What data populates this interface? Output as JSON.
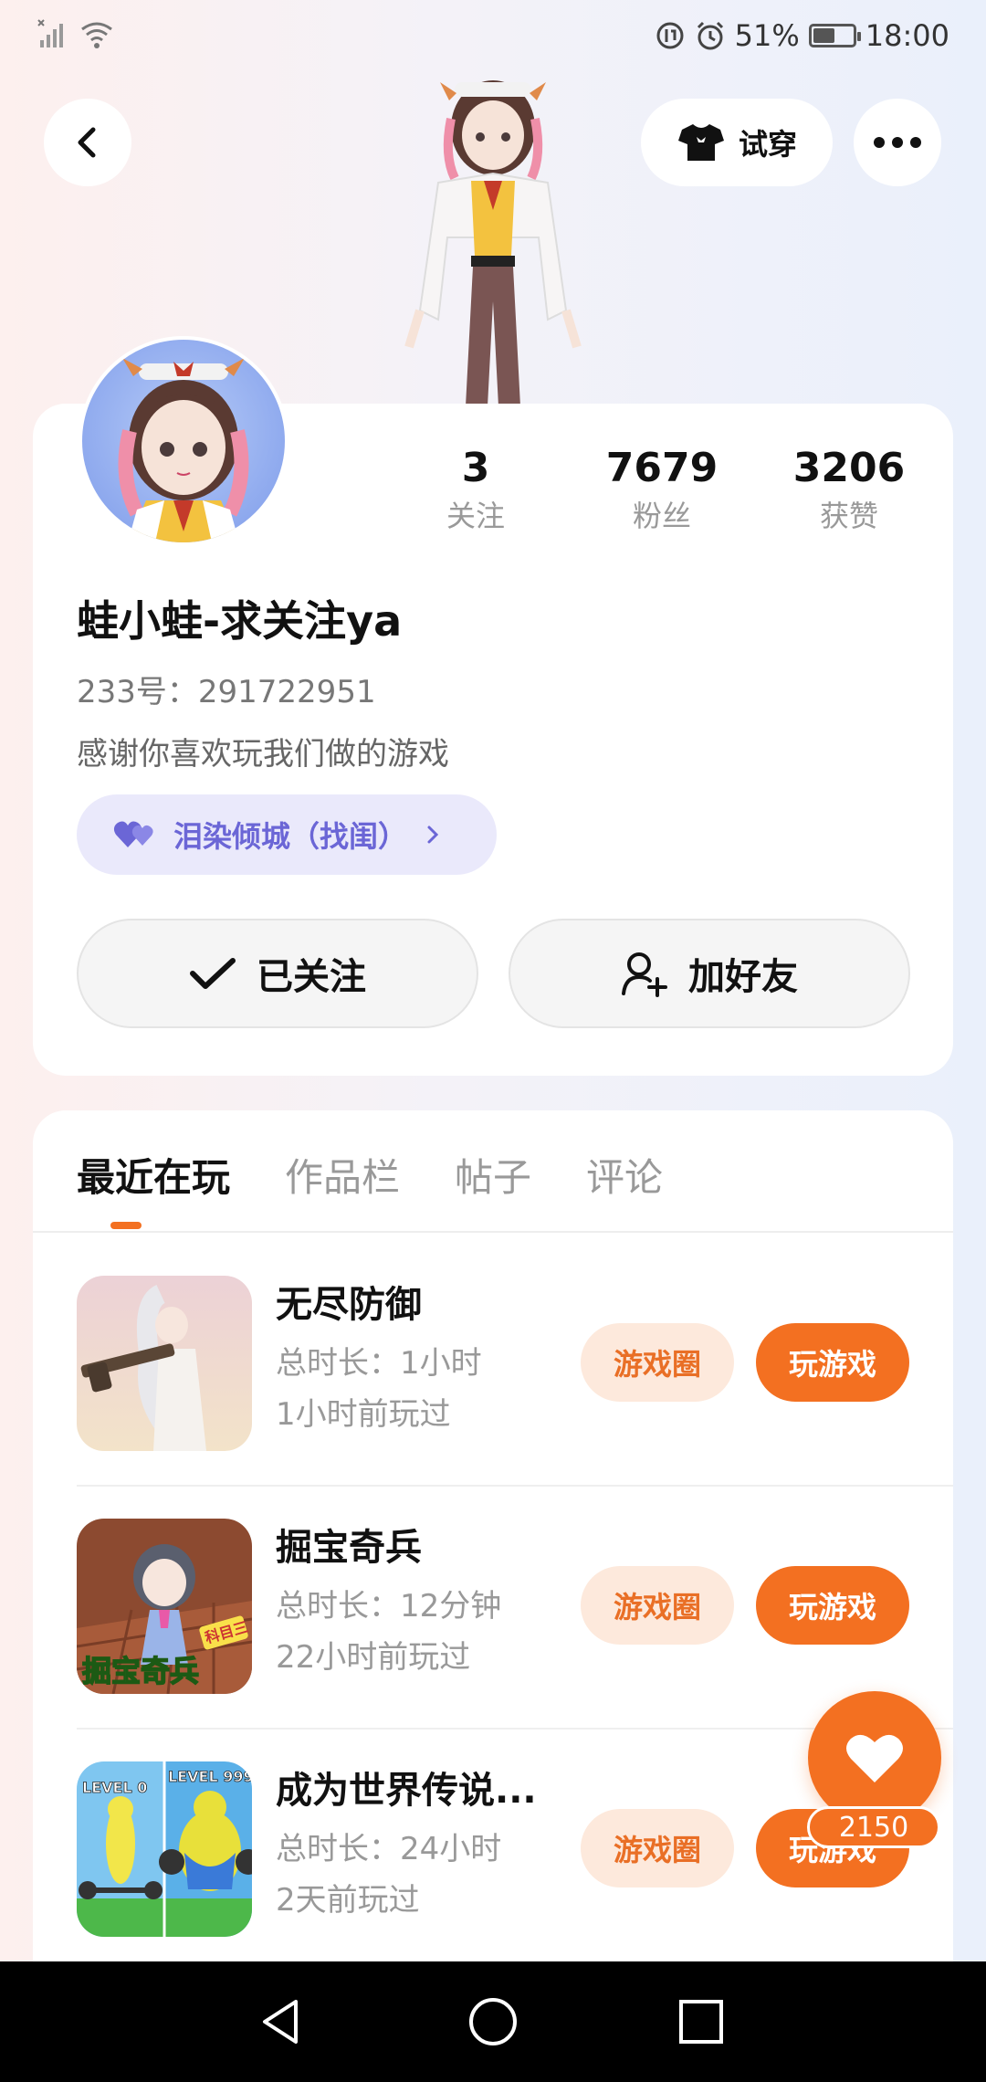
{
  "status_bar": {
    "battery_percent_text": "51%",
    "battery_level": 0.51,
    "time": "18:00",
    "icons": [
      "no-signal-icon",
      "wifi-icon",
      "data-saver-icon",
      "alarm-icon",
      "battery-icon"
    ]
  },
  "header": {
    "back_icon": "chevron-left-icon",
    "try_on_label": "试穿",
    "try_on_icon": "tshirt-icon",
    "more_icon": "more-dots-icon"
  },
  "profile": {
    "stats": [
      {
        "value": "3",
        "label": "关注"
      },
      {
        "value": "7679",
        "label": "粉丝"
      },
      {
        "value": "3206",
        "label": "获赞"
      }
    ],
    "username": "蛙小蛙-求关注ya",
    "uid": "233号：291722951",
    "bio": "感谢你喜欢玩我们做的游戏",
    "tag_label": "泪染倾城（找闺）",
    "followed_label": "已关注",
    "add_friend_label": "加好友"
  },
  "tabs": [
    {
      "label": "最近在玩",
      "active": true
    },
    {
      "label": "作品栏",
      "active": false
    },
    {
      "label": "帖子",
      "active": false
    },
    {
      "label": "评论",
      "active": false
    }
  ],
  "games": [
    {
      "title": "无尽防御",
      "duration": "总时长：1小时",
      "last_played": "1小时前玩过",
      "circle_label": "游戏圈",
      "play_label": "玩游戏"
    },
    {
      "title": "掘宝奇兵",
      "duration": "总时长：12分钟",
      "last_played": "22小时前玩过",
      "circle_label": "游戏圈",
      "play_label": "玩游戏",
      "icon_text": "掘宝奇兵",
      "icon_badge": "科目三"
    },
    {
      "title": "成为世界传说...",
      "duration": "总时长：24小时",
      "last_played": "2天前玩过",
      "circle_label": "游戏圈",
      "play_label": "玩游戏",
      "icon_text_left": "LEVEL 0",
      "icon_text_right": "LEVEL 999"
    }
  ],
  "like": {
    "count": "2150",
    "icon": "heart-icon"
  },
  "colors": {
    "accent": "#f37021",
    "accent_light": "#fde9dc",
    "tag_bg": "#eae9fb",
    "tag_text": "#6b66d6"
  }
}
